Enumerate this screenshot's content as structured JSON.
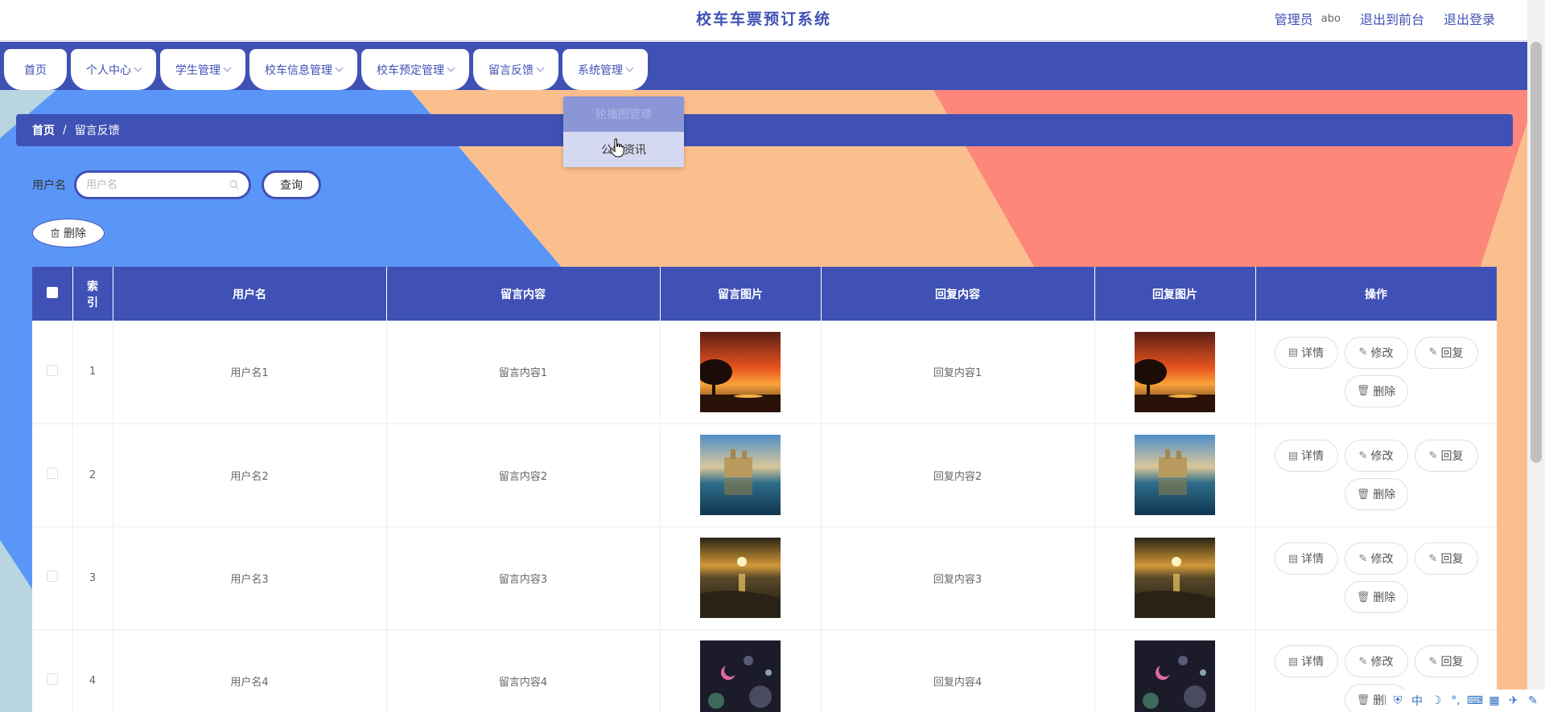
{
  "app": {
    "title": "校车车票预订系统"
  },
  "header": {
    "role": "管理员",
    "username": "abo",
    "front_link": "退出到前台",
    "logout_link": "退出登录"
  },
  "nav": {
    "items": [
      "首页",
      "个人中心",
      "学生管理",
      "校车信息管理",
      "校车预定管理",
      "留言反馈",
      "系统管理"
    ]
  },
  "dropdown": {
    "items": [
      "轮播图管理",
      "公告资讯"
    ]
  },
  "breadcrumb": {
    "home": "首页",
    "separator": "/",
    "current": "留言反馈"
  },
  "search": {
    "label": "用户名",
    "placeholder": "用户名",
    "value": "",
    "button": "查询"
  },
  "toolbar": {
    "delete_label": "删除"
  },
  "table": {
    "headers": [
      "索引",
      "用户名",
      "留言内容",
      "留言图片",
      "回复内容",
      "回复图片",
      "操作"
    ],
    "actions": {
      "detail": "详情",
      "edit": "修改",
      "reply": "回复",
      "delete": "删除"
    },
    "rows": [
      {
        "index": "1",
        "username": "用户名1",
        "content": "留言内容1",
        "reply": "回复内容1",
        "image": "sunset-tree"
      },
      {
        "index": "2",
        "username": "用户名2",
        "content": "留言内容2",
        "reply": "回复内容2",
        "image": "castle-lake"
      },
      {
        "index": "3",
        "username": "用户名3",
        "content": "留言内容3",
        "reply": "回复内容3",
        "image": "sea-sunset"
      },
      {
        "index": "4",
        "username": "用户名4",
        "content": "留言内容4",
        "reply": "回复内容4",
        "image": "night-moon"
      }
    ]
  },
  "tray": {
    "lang": "中"
  },
  "colors": {
    "primary": "#3f51b5",
    "bg_blue": "#5a96f8",
    "bg_peach": "#fbbf8e",
    "bg_coral": "#fd877a",
    "bg_lightblue": "#b9d5e0"
  }
}
